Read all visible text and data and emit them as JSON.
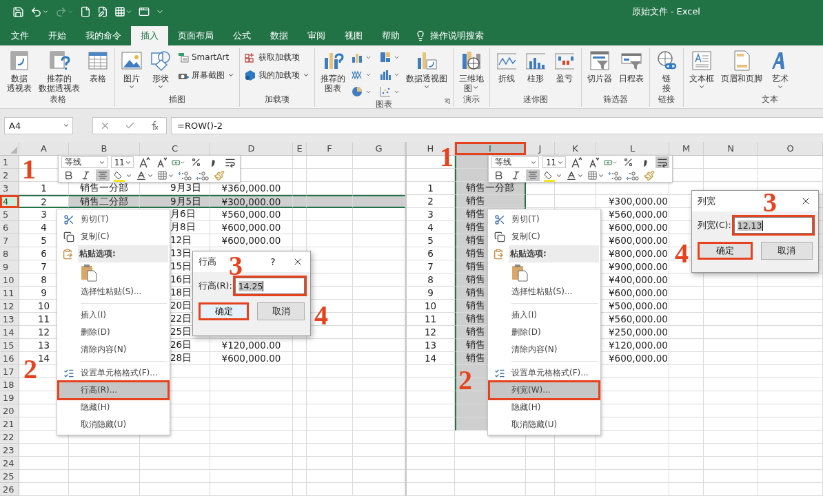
{
  "window": {
    "title": "原始文件 - Excel"
  },
  "quick_access": {
    "redo_disabled": true
  },
  "tabs": [
    {
      "label": "文件",
      "selected": false
    },
    {
      "label": "开始",
      "selected": false
    },
    {
      "label": "我的命令",
      "selected": false
    },
    {
      "label": "插入",
      "selected": true
    },
    {
      "label": "页面布局",
      "selected": false
    },
    {
      "label": "公式",
      "selected": false
    },
    {
      "label": "数据",
      "selected": false
    },
    {
      "label": "审阅",
      "selected": false
    },
    {
      "label": "视图",
      "selected": false
    },
    {
      "label": "帮助",
      "selected": false
    }
  ],
  "tell_me": "操作说明搜索",
  "ribbon": [
    {
      "label": "表格",
      "items": [
        {
          "kind": "large",
          "lines": [
            "数据",
            "透视表"
          ],
          "dropdown": false
        },
        {
          "kind": "large",
          "lines": [
            "推荐的",
            "数据透视表"
          ],
          "dropdown": false
        },
        {
          "kind": "large",
          "lines": [
            "表格"
          ],
          "dropdown": false
        }
      ]
    },
    {
      "label": "插图",
      "items": [
        {
          "kind": "large",
          "lines": [
            "图片"
          ],
          "dropdown": true
        },
        {
          "kind": "large",
          "lines": [
            "形状"
          ],
          "dropdown": true
        },
        {
          "kind": "small-stack",
          "entries": [
            {
              "label": "SmartArt",
              "dropdown": false
            },
            {
              "label": "屏幕截图",
              "dropdown": true
            }
          ]
        }
      ]
    },
    {
      "label": "加载项",
      "items": [
        {
          "kind": "small-stack",
          "entries": [
            {
              "label": "获取加载项",
              "dropdown": false
            },
            {
              "label": "我的加载项",
              "dropdown": true
            }
          ]
        }
      ]
    },
    {
      "label": "图表",
      "launcher": true,
      "items": [
        {
          "kind": "large",
          "lines": [
            "推荐的",
            "图表"
          ],
          "dropdown": false
        },
        {
          "kind": "chart-gallery"
        },
        {
          "kind": "large",
          "lines": [
            "数据透视图"
          ],
          "dropdown": true
        }
      ]
    },
    {
      "label": "演示",
      "items": [
        {
          "kind": "large",
          "lines": [
            "三维地",
            "图"
          ],
          "dropdown": true
        }
      ]
    },
    {
      "label": "迷你图",
      "items": [
        {
          "kind": "large",
          "lines": [
            "折线"
          ],
          "dropdown": false
        },
        {
          "kind": "large",
          "lines": [
            "柱形"
          ],
          "dropdown": false
        },
        {
          "kind": "large",
          "lines": [
            "盈亏"
          ],
          "dropdown": false
        }
      ]
    },
    {
      "label": "筛选器",
      "items": [
        {
          "kind": "large",
          "lines": [
            "切片器"
          ],
          "dropdown": false
        },
        {
          "kind": "large",
          "lines": [
            "日程表"
          ],
          "dropdown": false
        }
      ]
    },
    {
      "label": "链接",
      "items": [
        {
          "kind": "large",
          "lines": [
            "链",
            "接"
          ],
          "dropdown": false
        }
      ]
    },
    {
      "label": "文本",
      "items": [
        {
          "kind": "large",
          "lines": [
            "文本框"
          ],
          "dropdown": true
        },
        {
          "kind": "large",
          "lines": [
            "页眉和页脚"
          ],
          "dropdown": false
        },
        {
          "kind": "large",
          "lines": [
            "艺术"
          ],
          "dropdown": true
        }
      ]
    }
  ],
  "formula_bar": {
    "name_box": "A4",
    "formula": "=ROW()-2"
  },
  "left_sheet": {
    "columns": [
      {
        "label": "A",
        "selected": false
      },
      {
        "label": "B",
        "selected": false
      },
      {
        "label": "C",
        "selected": false
      },
      {
        "label": "D",
        "selected": false
      },
      {
        "label": "E",
        "selected": false
      },
      {
        "label": "F",
        "selected": false
      },
      {
        "label": "G",
        "selected": false
      }
    ],
    "rows": [
      {
        "header": "1",
        "selected": false,
        "marked": false
      },
      {
        "header": "2",
        "selected": false,
        "marked": false
      },
      {
        "header": "3",
        "selected": false,
        "marked": false,
        "cells": {
          "a": "1",
          "b": "销售一分部",
          "c": "9月3日",
          "d": "¥360,000.00"
        }
      },
      {
        "header": "4",
        "selected": true,
        "marked": true,
        "cells": {
          "a": "2",
          "b": "销售二分部",
          "c": "9月5日",
          "d": "¥300,000.00"
        }
      },
      {
        "header": "5",
        "selected": false,
        "marked": false,
        "cells": {
          "a": "3",
          "c": "月6日",
          "d": "¥560,000.00"
        }
      },
      {
        "header": "6",
        "selected": false,
        "marked": false,
        "cells": {
          "a": "4",
          "c": "月8日",
          "d": "¥600,000.00"
        }
      },
      {
        "header": "7",
        "selected": false,
        "marked": false,
        "cells": {
          "a": "5",
          "c": "12日",
          "d": "¥600,000.00"
        }
      },
      {
        "header": "8",
        "selected": false,
        "marked": false,
        "cells": {
          "a": "6",
          "c": "13日"
        }
      },
      {
        "header": "9",
        "selected": false,
        "marked": false,
        "cells": {
          "a": "7",
          "c": "15日"
        }
      },
      {
        "header": "10",
        "selected": false,
        "marked": false,
        "cells": {
          "a": "8",
          "c": "16日"
        }
      },
      {
        "header": "11",
        "selected": false,
        "marked": false,
        "cells": {
          "a": "9",
          "c": "18日"
        }
      },
      {
        "header": "12",
        "selected": false,
        "marked": false,
        "cells": {
          "a": "10",
          "c": "20日"
        }
      },
      {
        "header": "13",
        "selected": false,
        "marked": false,
        "cells": {
          "a": "11",
          "c": "22日"
        }
      },
      {
        "header": "14",
        "selected": false,
        "marked": false,
        "cells": {
          "a": "12",
          "c": "25日"
        }
      },
      {
        "header": "15",
        "selected": false,
        "marked": false,
        "cells": {
          "a": "13",
          "c": "26日",
          "d": "¥120,000.00"
        }
      },
      {
        "header": "16",
        "selected": false,
        "marked": false,
        "cells": {
          "a": "14",
          "c": "28日",
          "d": "¥600,000.00"
        }
      },
      {
        "header": "17",
        "selected": false,
        "marked": false
      },
      {
        "header": "18",
        "selected": false,
        "marked": false
      },
      {
        "header": "19",
        "selected": false,
        "marked": false
      },
      {
        "header": "20",
        "selected": false,
        "marked": false
      },
      {
        "header": "21",
        "selected": false,
        "marked": false
      },
      {
        "header": "22",
        "selected": false,
        "marked": false
      },
      {
        "header": "23",
        "selected": false,
        "marked": false
      },
      {
        "header": "24",
        "selected": false,
        "marked": false
      },
      {
        "header": "25",
        "selected": false,
        "marked": false
      },
      {
        "header": "26",
        "selected": false,
        "marked": false
      }
    ],
    "mini_toolbar": {
      "font": "等线",
      "size": "11",
      "align_center": {
        "on": true
      },
      "wrap_text": {
        "on": false
      }
    },
    "context_menu": {
      "items": [
        {
          "kind": "item",
          "label": "剪切(T)",
          "icon": true,
          "highlighted": false,
          "marked": false
        },
        {
          "kind": "item",
          "label": "复制(C)",
          "icon": true,
          "highlighted": false,
          "marked": false
        },
        {
          "kind": "header",
          "label": "粘贴选项:"
        },
        {
          "kind": "paste-option"
        },
        {
          "kind": "item",
          "label": "选择性粘贴(S)...",
          "icon": false,
          "highlighted": false,
          "marked": false
        },
        {
          "kind": "separator"
        },
        {
          "kind": "item",
          "label": "插入(I)",
          "icon": false,
          "highlighted": false,
          "marked": false
        },
        {
          "kind": "item",
          "label": "删除(D)",
          "icon": false,
          "highlighted": false,
          "marked": false
        },
        {
          "kind": "item",
          "label": "清除内容(N)",
          "icon": false,
          "highlighted": false,
          "marked": false
        },
        {
          "kind": "separator"
        },
        {
          "kind": "item",
          "label": "设置单元格格式(F)...",
          "icon": true,
          "highlighted": false,
          "marked": false
        },
        {
          "kind": "item",
          "label": "行高(R)...",
          "icon": false,
          "highlighted": true,
          "marked": true
        },
        {
          "kind": "item",
          "label": "隐藏(H)",
          "icon": false,
          "highlighted": false,
          "marked": false
        },
        {
          "kind": "item",
          "label": "取消隐藏(U)",
          "icon": false,
          "highlighted": false,
          "marked": false
        }
      ]
    },
    "dialog": {
      "title": "行高",
      "help": "?",
      "label": "行高(R):",
      "value": "14.25",
      "value_marked": true,
      "buttons": [
        {
          "label": "确定",
          "focused": true,
          "marked": true
        },
        {
          "label": "取消",
          "focused": false,
          "marked": false
        }
      ]
    },
    "annotations": [
      {
        "label": "1"
      },
      {
        "label": "2"
      },
      {
        "label": "3"
      },
      {
        "label": "4"
      }
    ]
  },
  "right_sheet": {
    "columns": [
      {
        "label": "H",
        "selected": false,
        "marked": false
      },
      {
        "label": "I",
        "selected": true,
        "marked": true
      },
      {
        "label": "J",
        "selected": false,
        "marked": false
      },
      {
        "label": "K",
        "selected": false,
        "marked": false
      },
      {
        "label": "L",
        "selected": false,
        "marked": false
      },
      {
        "label": "M",
        "selected": false,
        "marked": false
      },
      {
        "label": "N",
        "selected": false,
        "marked": false
      },
      {
        "label": "O",
        "selected": false,
        "marked": false
      }
    ],
    "rows": [
      {
        "cells": {
          "h": "1",
          "i": "销售一分部"
        }
      },
      {
        "cells": {
          "h": "2",
          "i": "销售",
          "l": "¥300,000.00"
        }
      },
      {
        "cells": {
          "h": "3",
          "i": "销售",
          "l": "¥560,000.00"
        }
      },
      {
        "cells": {
          "h": "4",
          "i": "销售",
          "l": "¥600,000.00"
        }
      },
      {
        "cells": {
          "h": "5",
          "i": "销售",
          "l": "¥600,000.00"
        }
      },
      {
        "cells": {
          "h": "6",
          "i": "销售",
          "l": "¥800,000.00"
        }
      },
      {
        "cells": {
          "h": "7",
          "i": "销售",
          "l": "¥900,000.00"
        }
      },
      {
        "cells": {
          "h": "8",
          "i": "销售",
          "l": "¥400,000.00"
        }
      },
      {
        "cells": {
          "h": "9",
          "i": "销售",
          "l": "¥600,000.00"
        }
      },
      {
        "cells": {
          "h": "10",
          "i": "销售",
          "l": "¥500,000.00"
        }
      },
      {
        "cells": {
          "h": "11",
          "i": "销售",
          "l": "¥560,000.00"
        }
      },
      {
        "cells": {
          "h": "12",
          "i": "销售",
          "l": "¥250,000.00"
        }
      },
      {
        "cells": {
          "h": "13",
          "i": "销售",
          "l": "¥120,000.00"
        }
      },
      {
        "cells": {
          "h": "14",
          "i": "销售",
          "l": "¥600,000.00"
        }
      }
    ],
    "mini_toolbar": {
      "font": "等线",
      "size": "11",
      "align_center": {
        "on": true
      },
      "wrap_text": {
        "on": true
      }
    },
    "context_menu": {
      "items": [
        {
          "kind": "item",
          "label": "剪切(T)",
          "icon": true,
          "highlighted": false,
          "marked": false
        },
        {
          "kind": "item",
          "label": "复制(C)",
          "icon": true,
          "highlighted": false,
          "marked": false
        },
        {
          "kind": "header",
          "label": "粘贴选项:"
        },
        {
          "kind": "paste-option"
        },
        {
          "kind": "item",
          "label": "选择性粘贴(S)...",
          "icon": false,
          "highlighted": false,
          "marked": false
        },
        {
          "kind": "separator"
        },
        {
          "kind": "item",
          "label": "插入(I)",
          "icon": false,
          "highlighted": false,
          "marked": false
        },
        {
          "kind": "item",
          "label": "删除(D)",
          "icon": false,
          "highlighted": false,
          "marked": false
        },
        {
          "kind": "item",
          "label": "清除内容(N)",
          "icon": false,
          "highlighted": false,
          "marked": false
        },
        {
          "kind": "separator"
        },
        {
          "kind": "item",
          "label": "设置单元格格式(F)...",
          "icon": true,
          "highlighted": false,
          "marked": false
        },
        {
          "kind": "item",
          "label": "列宽(W)...",
          "icon": false,
          "highlighted": true,
          "marked": true
        },
        {
          "kind": "item",
          "label": "隐藏(H)",
          "icon": false,
          "highlighted": false,
          "marked": false
        },
        {
          "kind": "item",
          "label": "取消隐藏(U)",
          "icon": false,
          "highlighted": false,
          "marked": false
        }
      ]
    },
    "dialog": {
      "title": "列宽",
      "label": "列宽(C):",
      "value": "12.13",
      "value_marked": true,
      "buttons": [
        {
          "label": "确定",
          "focused": false,
          "marked": true
        },
        {
          "label": "取消",
          "focused": false,
          "marked": false
        }
      ]
    },
    "annotations": [
      {
        "label": "1"
      },
      {
        "label": "2"
      },
      {
        "label": "3"
      },
      {
        "label": "4"
      }
    ]
  }
}
